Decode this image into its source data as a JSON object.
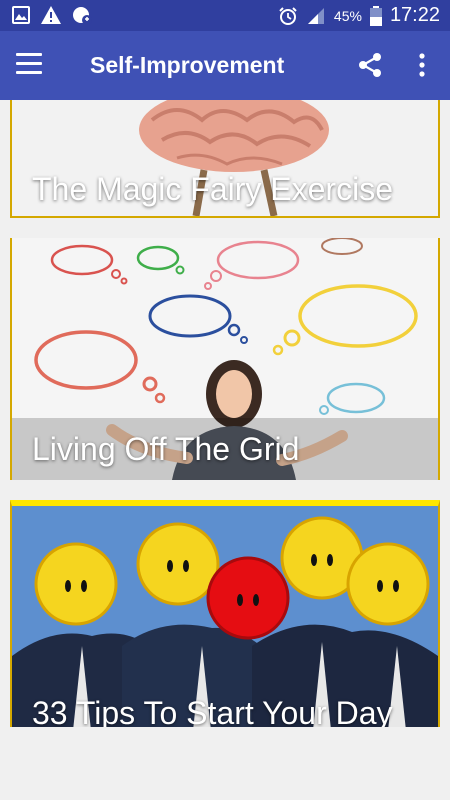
{
  "status_bar": {
    "battery": "45%",
    "time": "17:22",
    "icons": [
      "gallery-icon",
      "warning-icon",
      "data-saver-icon",
      "alarm-icon",
      "signal-icon",
      "battery-icon"
    ]
  },
  "app_bar": {
    "title": "Self-Improvement",
    "icons": [
      "menu-icon",
      "share-icon",
      "more-vert-icon"
    ]
  },
  "colors": {
    "status_bar": "#303f9f",
    "app_bar": "#3f51b5",
    "card_border": "#d4a800",
    "card3_top": "#ffe600"
  },
  "articles": [
    {
      "title": "The Magic Fairy Exercise",
      "image": "brain-with-legs-illustration"
    },
    {
      "title": "Living Off The Grid",
      "image": "girl-with-thought-bubbles-photo"
    },
    {
      "title": "33 Tips To Start Your Day",
      "image": "smiley-face-businessmen-illustration"
    }
  ]
}
